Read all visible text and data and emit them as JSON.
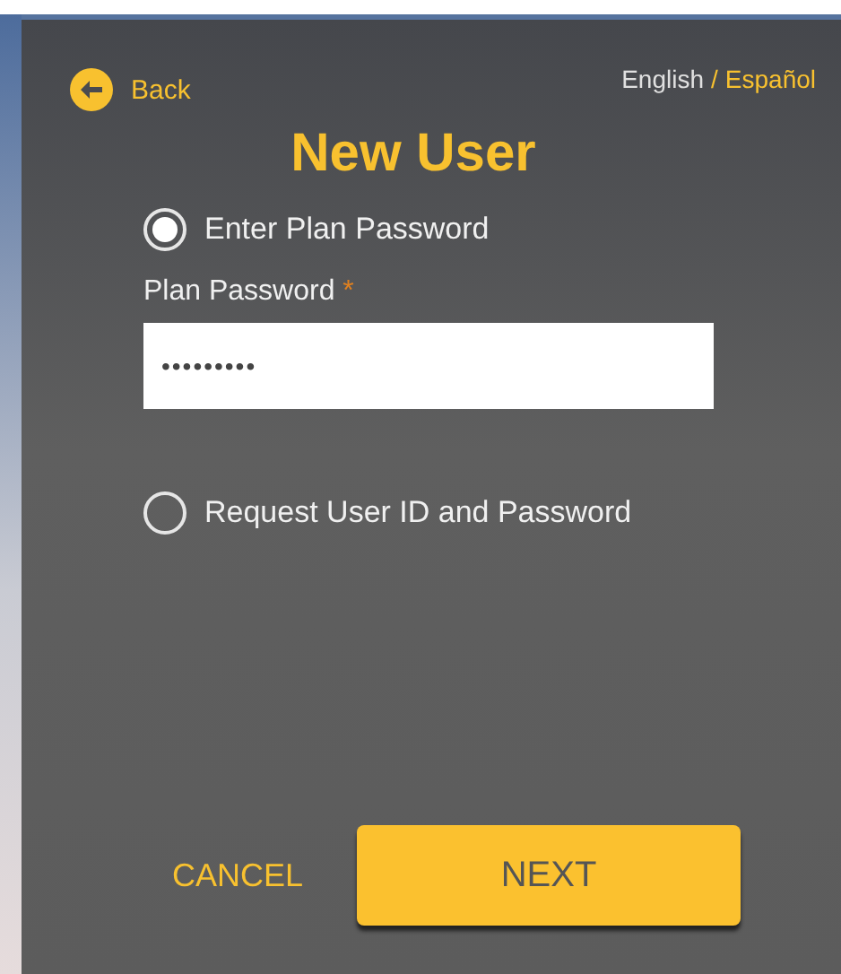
{
  "back": {
    "label": "Back"
  },
  "languages": [
    {
      "label": "English",
      "selected": true
    },
    {
      "label": "Español",
      "selected": false
    }
  ],
  "language_separator": "/",
  "title": "New User",
  "options": [
    {
      "label": "Enter Plan Password",
      "selected": true
    },
    {
      "label": "Request User ID and Password",
      "selected": false
    }
  ],
  "password_field": {
    "label": "Plan Password",
    "required_mark": "*",
    "value": "•••••••••"
  },
  "buttons": {
    "cancel": "CANCEL",
    "next": "NEXT"
  }
}
